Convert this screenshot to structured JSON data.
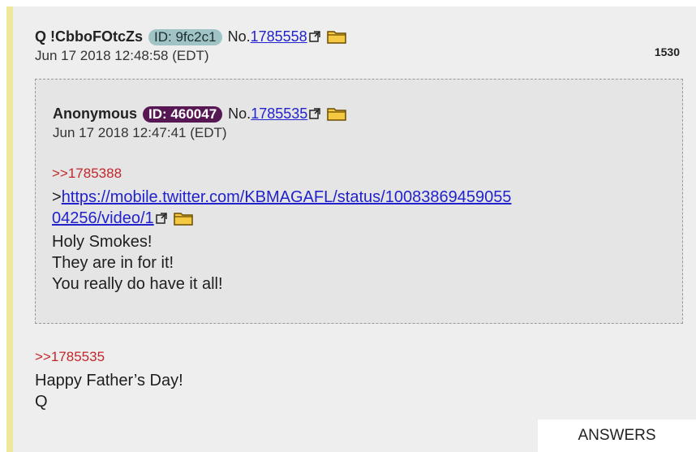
{
  "post": {
    "name": "Q !CbboFOtcZs",
    "id_label": "ID: 9fc2c1",
    "no_prefix": "No.",
    "number": "1785558",
    "date": "Jun 17 2018 12:48:58 (EDT)",
    "count": "1530",
    "reply_ref": ">>1785535",
    "lines": [
      "Happy Father’s Day!",
      "Q"
    ],
    "answers_label": "ANSWERS"
  },
  "quoted": {
    "name": "Anonymous",
    "id_label": "ID: 460047",
    "no_prefix": "No.",
    "number": "1785535",
    "date": "Jun 17 2018 12:47:41 (EDT)",
    "reply_ref": ">>1785388",
    "link_prefix": ">",
    "link_line1": "https://mobile.twitter.com/KBMAGAFL/status/10083869459055",
    "link_line2": "04256/video/1",
    "lines": [
      "Holy Smokes!",
      "They are in for it!",
      "You really do have it all!"
    ]
  },
  "colors": {
    "id_green": "#a0c4c6",
    "id_purple": "#561753",
    "reply_ref": "#c2262b",
    "link": "#2222cc",
    "accent_bar": "#efe89a"
  },
  "icons": {
    "external": "external-link-icon",
    "folder": "folder-icon"
  }
}
